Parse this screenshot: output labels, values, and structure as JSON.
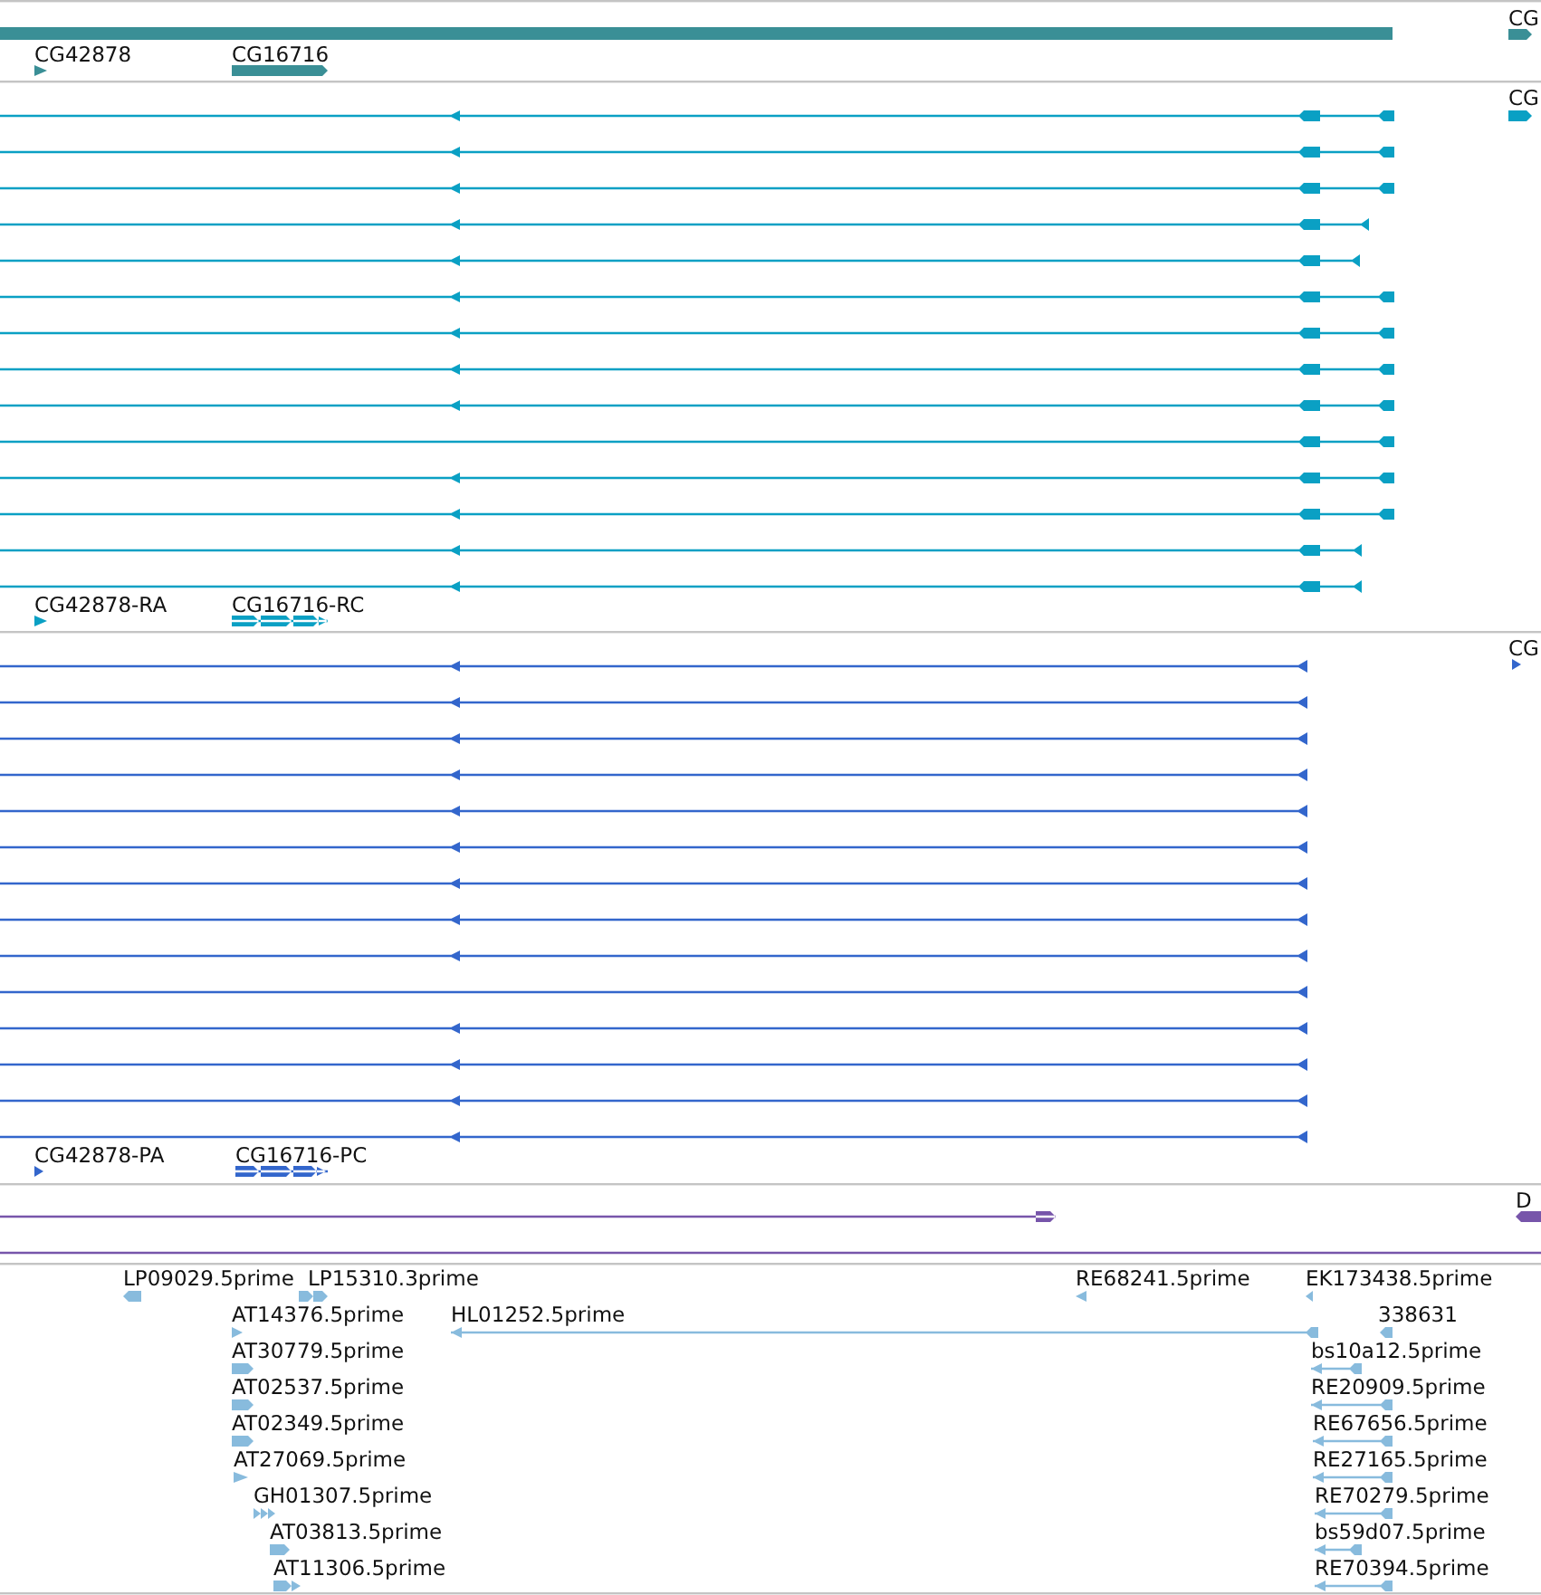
{
  "tracks": [
    {
      "kind": "gene",
      "color": "#3a8f96",
      "labels": [
        "CG",
        "CG42878",
        "CG16716"
      ]
    },
    {
      "kind": "transcript",
      "color": "#0aa0c4",
      "labels": [
        "CG",
        "CG42878-RA",
        "CG16716-RC"
      ]
    },
    {
      "kind": "protein",
      "color": "#3366cc",
      "labels": [
        "CG",
        "CG42878-PA",
        "CG16716-PC"
      ]
    },
    {
      "kind": "region",
      "color": "#7755aa",
      "labels": [
        "D"
      ]
    },
    {
      "kind": "est",
      "color": "#88bbdd",
      "labels": [
        "LP09029.5prime",
        "LP15310.3prime",
        "RE68241.5prime",
        "EK173438.5prime",
        "AT14376.5prime",
        "HL01252.5prime",
        "338631",
        "AT30779.5prime",
        "bs10a12.5prime",
        "AT02537.5prime",
        "RE20909.5prime",
        "AT02349.5prime",
        "RE67656.5prime",
        "AT27069.5prime",
        "RE27165.5prime",
        "GH01307.5prime",
        "RE70279.5prime",
        "AT03813.5prime",
        "bs59d07.5prime",
        "AT11306.5prime",
        "RE70394.5prime"
      ]
    }
  ]
}
